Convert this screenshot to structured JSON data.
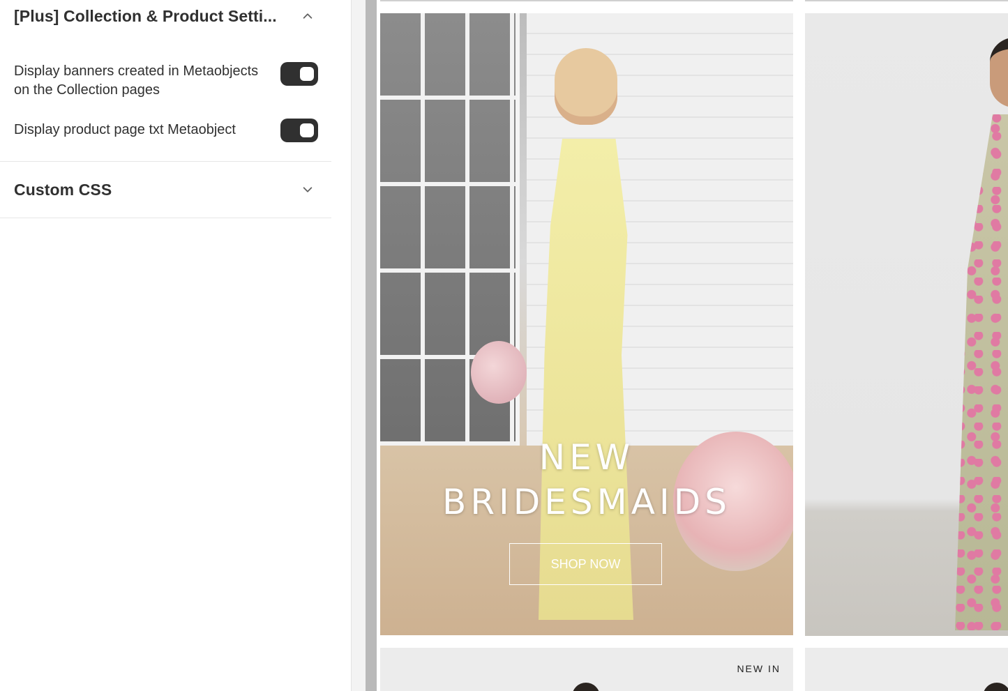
{
  "panel": {
    "collection_section": {
      "title": "[Plus] Collection & Product Setti...",
      "expanded": true,
      "settings": [
        {
          "label": "Display banners created in Metaobjects on the Collection pages",
          "enabled": true
        },
        {
          "label": "Display product page txt Metaobject",
          "enabled": true
        }
      ]
    },
    "custom_css_section": {
      "title": "Custom CSS",
      "expanded": false
    }
  },
  "preview": {
    "hero": {
      "line1": "NEW",
      "line2": "BRIDESMAIDS",
      "button": "SHOP NOW"
    },
    "next_tile_badge": "NEW IN"
  },
  "icons": {
    "collapse": "chevron-up-icon",
    "expand": "chevron-down-icon"
  },
  "colors": {
    "toggle_on": "#303030",
    "text": "#303030",
    "divider": "#e6e6e6"
  }
}
